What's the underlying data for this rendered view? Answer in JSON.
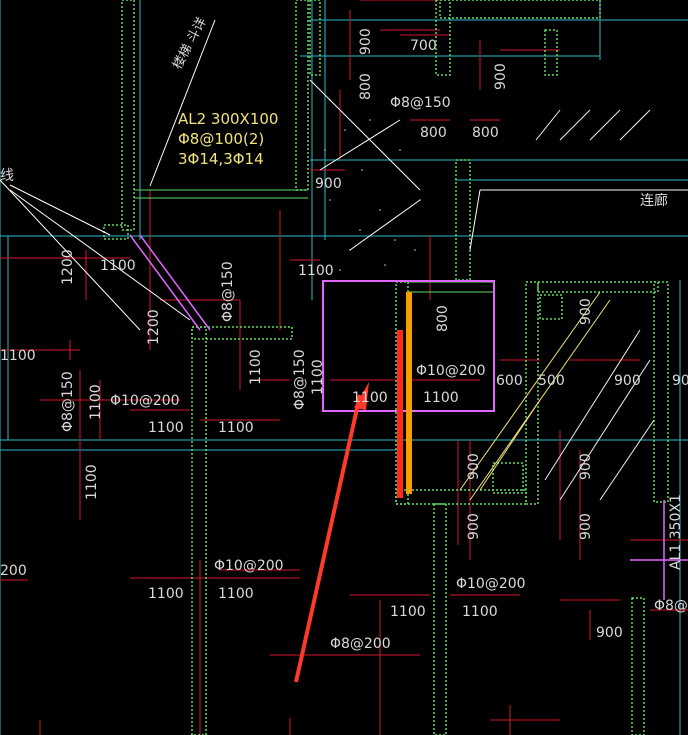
{
  "colors": {
    "background": "#000000",
    "wall_green": "#5fdc5f",
    "grid_cyan": "#2fb7c7",
    "rebar_red": "#d3192e",
    "leader_white": "#ffffff",
    "label_gray": "#d9d9d9",
    "label_yellow": "#f2e27a",
    "highlight_magenta": "#e066ff",
    "highlight_orange": "#f5a000",
    "highlight_red": "#ff2a1a",
    "arrow_red": "#ff3a2a"
  },
  "labels": {
    "beam_name": "AL2 300X100",
    "beam_stirrup": "Φ8@100(2)",
    "beam_bars": "3Φ14,3Φ14",
    "rotated_text": "楼梯 斗详",
    "corridor": "连廊",
    "left_edge": "线",
    "al1_partial": "AL1 350X1",
    "dims": {
      "d700": "700",
      "d800_top": "800",
      "d800_top2": "800",
      "d800_left": "800",
      "d900_top": "900",
      "d900_c": "900",
      "d900_top_right": "900",
      "d1200_a": "1200",
      "d1200_b": "1200",
      "d1100_top": "1100",
      "d1100_a": "1100",
      "d1100_b": "1100",
      "d1100_c": "1100",
      "d1100_d": "1100",
      "d1100_e": "1100",
      "d1100_f": "1100",
      "d1100_g": "1100",
      "d1100_h": "1100",
      "d1100_i": "1100",
      "d1100_j": "1100",
      "d1100_k": "1100",
      "d1100_l": "1100",
      "d1100_m": "1100",
      "d1100_n": "1100",
      "d800_box": "800",
      "d600": "600",
      "d500": "500",
      "d900_r1": "900",
      "d900_r2": "900",
      "d900_r3": "900",
      "d900_r4": "900",
      "d900_r5": "900",
      "d900_b1": "900",
      "d900_b2": "900",
      "d900_b3": "900",
      "d200_edge": "200"
    },
    "rebar": {
      "r_top": "Φ8@150",
      "r_v1": "Φ8@150",
      "r_v2": "Φ8@150",
      "r_v3": "Φ8@150",
      "r_a": "Φ10@200",
      "r_b": "Φ10@200",
      "r_c": "Φ10@200",
      "r_d": "Φ10@200",
      "r_e": "Φ8@200",
      "r_f": "Φ8@"
    }
  }
}
